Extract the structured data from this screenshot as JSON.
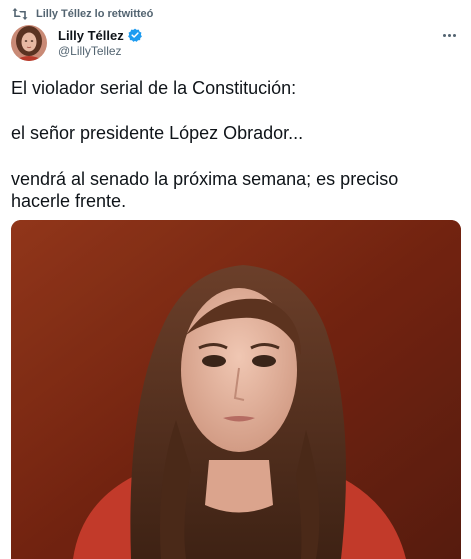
{
  "retweet": {
    "text": "Lilly Téllez lo retwitteó",
    "icon": "retweet-icon"
  },
  "author": {
    "display_name": "Lilly Téllez",
    "handle": "@LillyTellez",
    "verified": true,
    "avatar_icon": "avatar"
  },
  "tweet": {
    "line1": "El violador serial de la Constitución:",
    "line2": "el señor presidente López Obrador...",
    "line3": "vendrá al senado la próxima semana; es preciso hacerle frente."
  },
  "colors": {
    "text": "#0f1419",
    "secondary": "#536471",
    "verified": "#1d9bf0",
    "media_background": "#7d2a14"
  },
  "menu": {
    "icon": "more-icon"
  }
}
